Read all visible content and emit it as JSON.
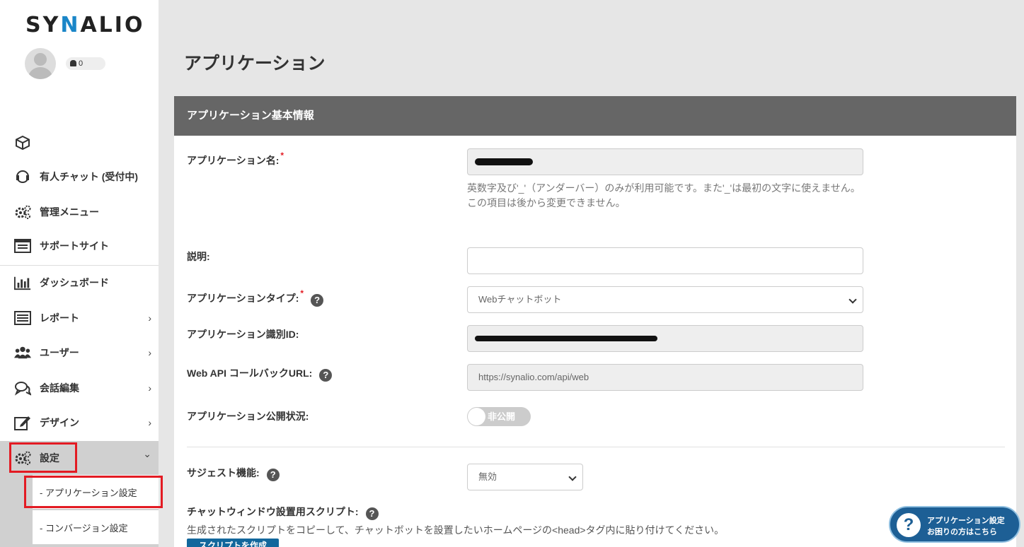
{
  "brand": {
    "prefix": "SY",
    "accent": "N",
    "suffix": "ALIO"
  },
  "header": {
    "notification_count": "0"
  },
  "sidebar": {
    "items": [
      {
        "label": "",
        "icon": "box-icon"
      },
      {
        "label": "有人チャット (受付中)",
        "icon": "headset-icon"
      },
      {
        "label": "管理メニュー",
        "icon": "gears-icon"
      },
      {
        "label": "サポートサイト",
        "icon": "window-icon"
      },
      {
        "label": "ダッシュボード",
        "icon": "bar-chart-icon"
      },
      {
        "label": "レポート",
        "icon": "list-icon",
        "chevron": "›"
      },
      {
        "label": "ユーザー",
        "icon": "users-icon",
        "chevron": "›"
      },
      {
        "label": "会話編集",
        "icon": "chat-icon",
        "chevron": "›"
      },
      {
        "label": "デザイン",
        "icon": "edit-icon",
        "chevron": "›"
      },
      {
        "label": "設定",
        "icon": "gears-icon",
        "chevron": "⌄"
      }
    ],
    "sub_items": [
      {
        "label": "-  アプリケーション設定"
      },
      {
        "label": "-  コンバージョン設定"
      }
    ]
  },
  "page": {
    "title": "アプリケーション"
  },
  "panel": {
    "header": "アプリケーション基本情報",
    "app_name": {
      "label": "アプリケーション名:",
      "required": "*",
      "help1": "英数字及び'_'（アンダーバー）のみが利用可能です。また'_'は最初の文字に使えません。",
      "help2": "この項目は後から変更できません。"
    },
    "description": {
      "label": "説明:",
      "value": ""
    },
    "app_type": {
      "label": "アプリケーションタイプ:",
      "required": "*",
      "value": "Webチャットボット"
    },
    "app_id": {
      "label": "アプリケーション識別ID:"
    },
    "webapi": {
      "label": "Web API コールバックURL:",
      "value": "https://synalio.com/api/web"
    },
    "publish": {
      "label": "アプリケーション公開状況:",
      "toggle_text": "非公開",
      "enabled": false
    },
    "suggest": {
      "label": "サジェスト機能:",
      "value": "無効"
    },
    "script": {
      "label": "チャットウィンドウ設置用スクリプト:",
      "desc": "生成されたスクリプトをコピーして、チャットボットを設置したいホームページの<head>タグ内に貼り付けてください。",
      "button": "スクリプトを作成"
    }
  },
  "floating_help": {
    "line1": "アプリケーション設定",
    "line2": "お困りの方はこちら"
  },
  "colors": {
    "accent": "#1a86c8",
    "highlight": "#e31b23",
    "header_bg": "#666666"
  }
}
